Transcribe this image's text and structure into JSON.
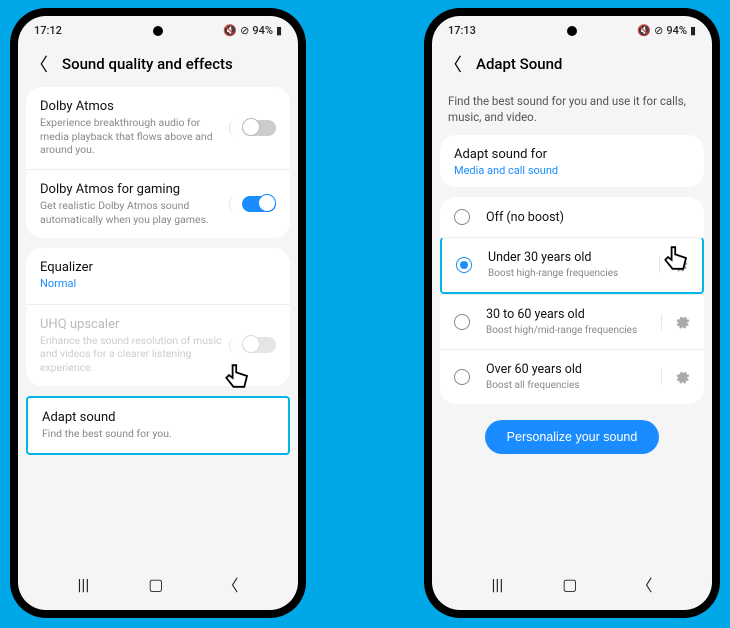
{
  "left": {
    "status": {
      "time": "17:12",
      "battery": "94%"
    },
    "title": "Sound quality and effects",
    "items": {
      "dolby": {
        "title": "Dolby Atmos",
        "sub": "Experience breakthrough audio for media playback that flows above and around you."
      },
      "dolby_gaming": {
        "title": "Dolby Atmos for gaming",
        "sub": "Get realistic Dolby Atmos sound automatically when you play games."
      },
      "eq": {
        "title": "Equalizer",
        "sub": "Normal"
      },
      "uhq": {
        "title": "UHQ upscaler",
        "sub": "Enhance the sound resolution of music and videos for a clearer listening experience."
      },
      "adapt": {
        "title": "Adapt sound",
        "sub": "Find the best sound for you."
      }
    }
  },
  "right": {
    "status": {
      "time": "17:13",
      "battery": "94%"
    },
    "title": "Adapt Sound",
    "intro": "Find the best sound for you and use it for calls, music, and video.",
    "section": {
      "title": "Adapt sound for",
      "sub": "Media and call sound"
    },
    "options": {
      "off": {
        "label": "Off (no boost)"
      },
      "under30": {
        "label": "Under 30 years old",
        "sub": "Boost high-range frequencies"
      },
      "mid": {
        "label": "30 to 60 years old",
        "sub": "Boost high/mid-range frequencies"
      },
      "over60": {
        "label": "Over 60 years old",
        "sub": "Boost all frequencies"
      }
    },
    "personalize": "Personalize your sound"
  },
  "icons": {
    "mute": "🔇",
    "alarm": "⏰",
    "bt": "✕"
  }
}
